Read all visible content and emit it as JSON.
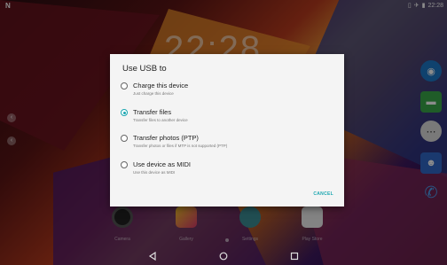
{
  "clock": "22:28",
  "dialog": {
    "title": "Use USB to",
    "options": [
      {
        "label": "Charge this device",
        "sub": "Just charge this device",
        "selected": false
      },
      {
        "label": "Transfer files",
        "sub": "Transfer files to another device",
        "selected": true
      },
      {
        "label": "Transfer photos (PTP)",
        "sub": "Transfer photos or files if MTP is not supported (PTP)",
        "selected": false
      },
      {
        "label": "Use device as MIDI",
        "sub": "Use this device as MIDI",
        "selected": false
      }
    ],
    "cancel_label": "CANCEL"
  },
  "dock": {
    "apps": [
      {
        "label": "Camera",
        "icon": "camera-icon"
      },
      {
        "label": "Gallery",
        "icon": "gallery-icon"
      },
      {
        "label": "Settings",
        "icon": "settings-icon"
      },
      {
        "label": "Play Store",
        "icon": "play-store-icon"
      }
    ]
  },
  "status": {
    "notification_icon": "N",
    "time": "22:28"
  },
  "colors": {
    "accent": "#1ba6b0",
    "dialog_bg": "#f4f4f4"
  }
}
